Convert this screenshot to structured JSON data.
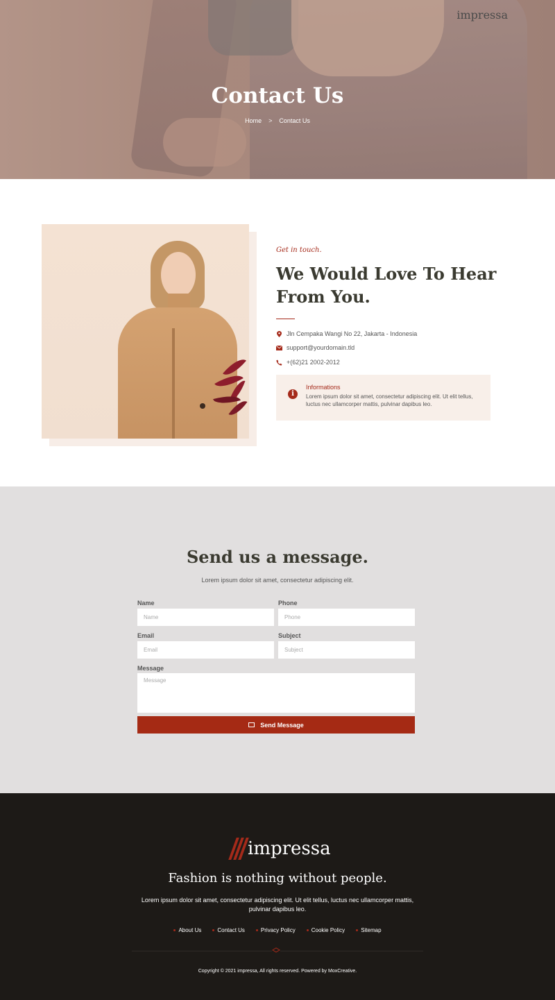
{
  "brand": {
    "name": "impressa",
    "accent": "#a52a1a"
  },
  "hero": {
    "title": "Contact Us",
    "breadcrumb": {
      "home": "Home",
      "separator": ">",
      "current": "Contact Us"
    }
  },
  "contact": {
    "eyebrow": "Get in touch.",
    "title": "We Would Love To Hear From You.",
    "address": "Jln Cempaka Wangi No 22, Jakarta - Indonesia",
    "email": "support@yourdomain.tld",
    "phone": "+(62)21 2002-2012",
    "info_box": {
      "title": "Informations",
      "text": "Lorem ipsum dolor sit amet, consectetur adipiscing elit. Ut elit tellus, luctus nec ullamcorper mattis, pulvinar dapibus leo."
    },
    "icons": {
      "address": "map-pin-icon",
      "email": "envelope-icon",
      "phone": "phone-icon",
      "info": "info-icon"
    }
  },
  "form": {
    "title": "Send us a message.",
    "subtitle": "Lorem ipsum dolor sit amet, consectetur adipiscing elit.",
    "name_label": "Name",
    "name_placeholder": "Name",
    "phone_label": "Phone",
    "phone_placeholder": "Phone",
    "email_label": "Email",
    "email_placeholder": "Email",
    "subject_label": "Subject",
    "subject_placeholder": "Subject",
    "message_label": "Message",
    "message_placeholder": "Message",
    "submit_label": "Send Message"
  },
  "footer": {
    "tagline": "Fashion is nothing without people.",
    "text": "Lorem ipsum dolor sit amet, consectetur adipiscing elit. Ut elit tellus, luctus nec ullamcorper mattis, pulvinar dapibus leo.",
    "links": [
      "About Us",
      "Contact Us",
      "Privacy Policy",
      "Cookie Policy",
      "Sitemap"
    ],
    "copyright": "Copyright © 2021 impressa, All rights reserved. Powered by MoxCreative."
  }
}
